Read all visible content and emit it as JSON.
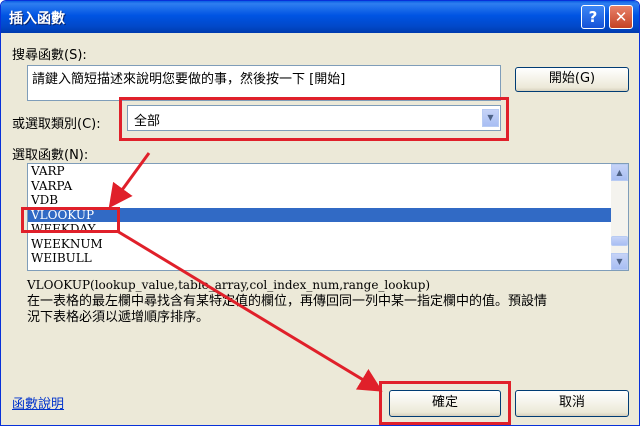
{
  "window": {
    "title": "插入函數",
    "help_icon": "?",
    "close_icon": "✕"
  },
  "search": {
    "label": "搜尋函數(S):",
    "value": "請鍵入簡短描述來說明您要做的事，然後按一下 [開始]",
    "go_button": "開始(G)"
  },
  "category": {
    "label": "或選取類別(C):",
    "selected": "全部"
  },
  "function_list": {
    "label": "選取函數(N):",
    "items": [
      "VARP",
      "VARPA",
      "VDB",
      "VLOOKUP",
      "WEEKDAY",
      "WEEKNUM",
      "WEIBULL"
    ],
    "selected_index": 3
  },
  "signature": "VLOOKUP(lookup_value,table_array,col_index_num,range_lookup)",
  "description": [
    "在一表格的最左欄中尋找含有某特定值的欄位，再傳回同一列中某一指定欄中的值。預設情",
    "況下表格必須以遞增順序排序。"
  ],
  "footer": {
    "help_link": "函數說明",
    "ok_button": "確定",
    "cancel_button": "取消"
  },
  "colors": {
    "annotation_red": "#e0202a",
    "selection_blue": "#316ac5",
    "title_blue": "#0054e3"
  }
}
